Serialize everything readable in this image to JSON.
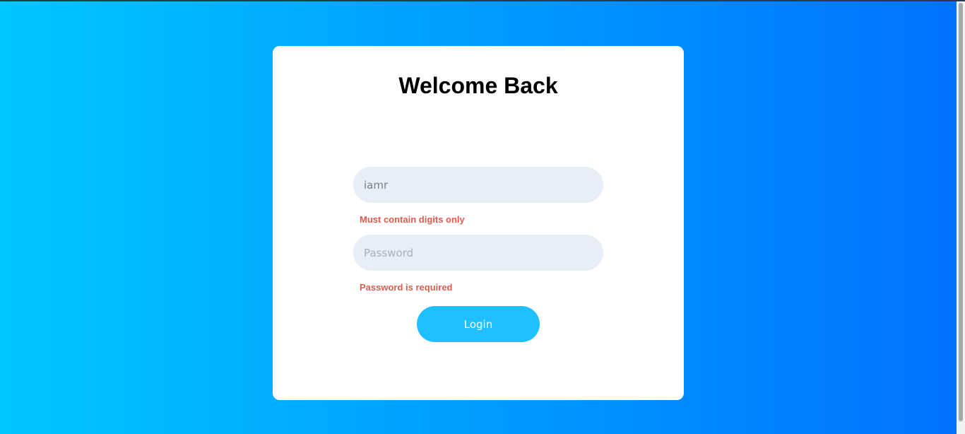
{
  "colors": {
    "gradient_start": "#00c6ff",
    "gradient_end": "#0072ff",
    "card_background": "#ffffff",
    "field_background": "#e8eef7",
    "error_text": "#e05a4e",
    "button_background": "#1ec0ff"
  },
  "login_card": {
    "title": "Welcome Back",
    "username": {
      "value": "iamr",
      "placeholder": "",
      "error": "Must contain digits only"
    },
    "password": {
      "value": "",
      "placeholder": "Password",
      "error": "Password is required"
    },
    "login_label": "Login"
  }
}
